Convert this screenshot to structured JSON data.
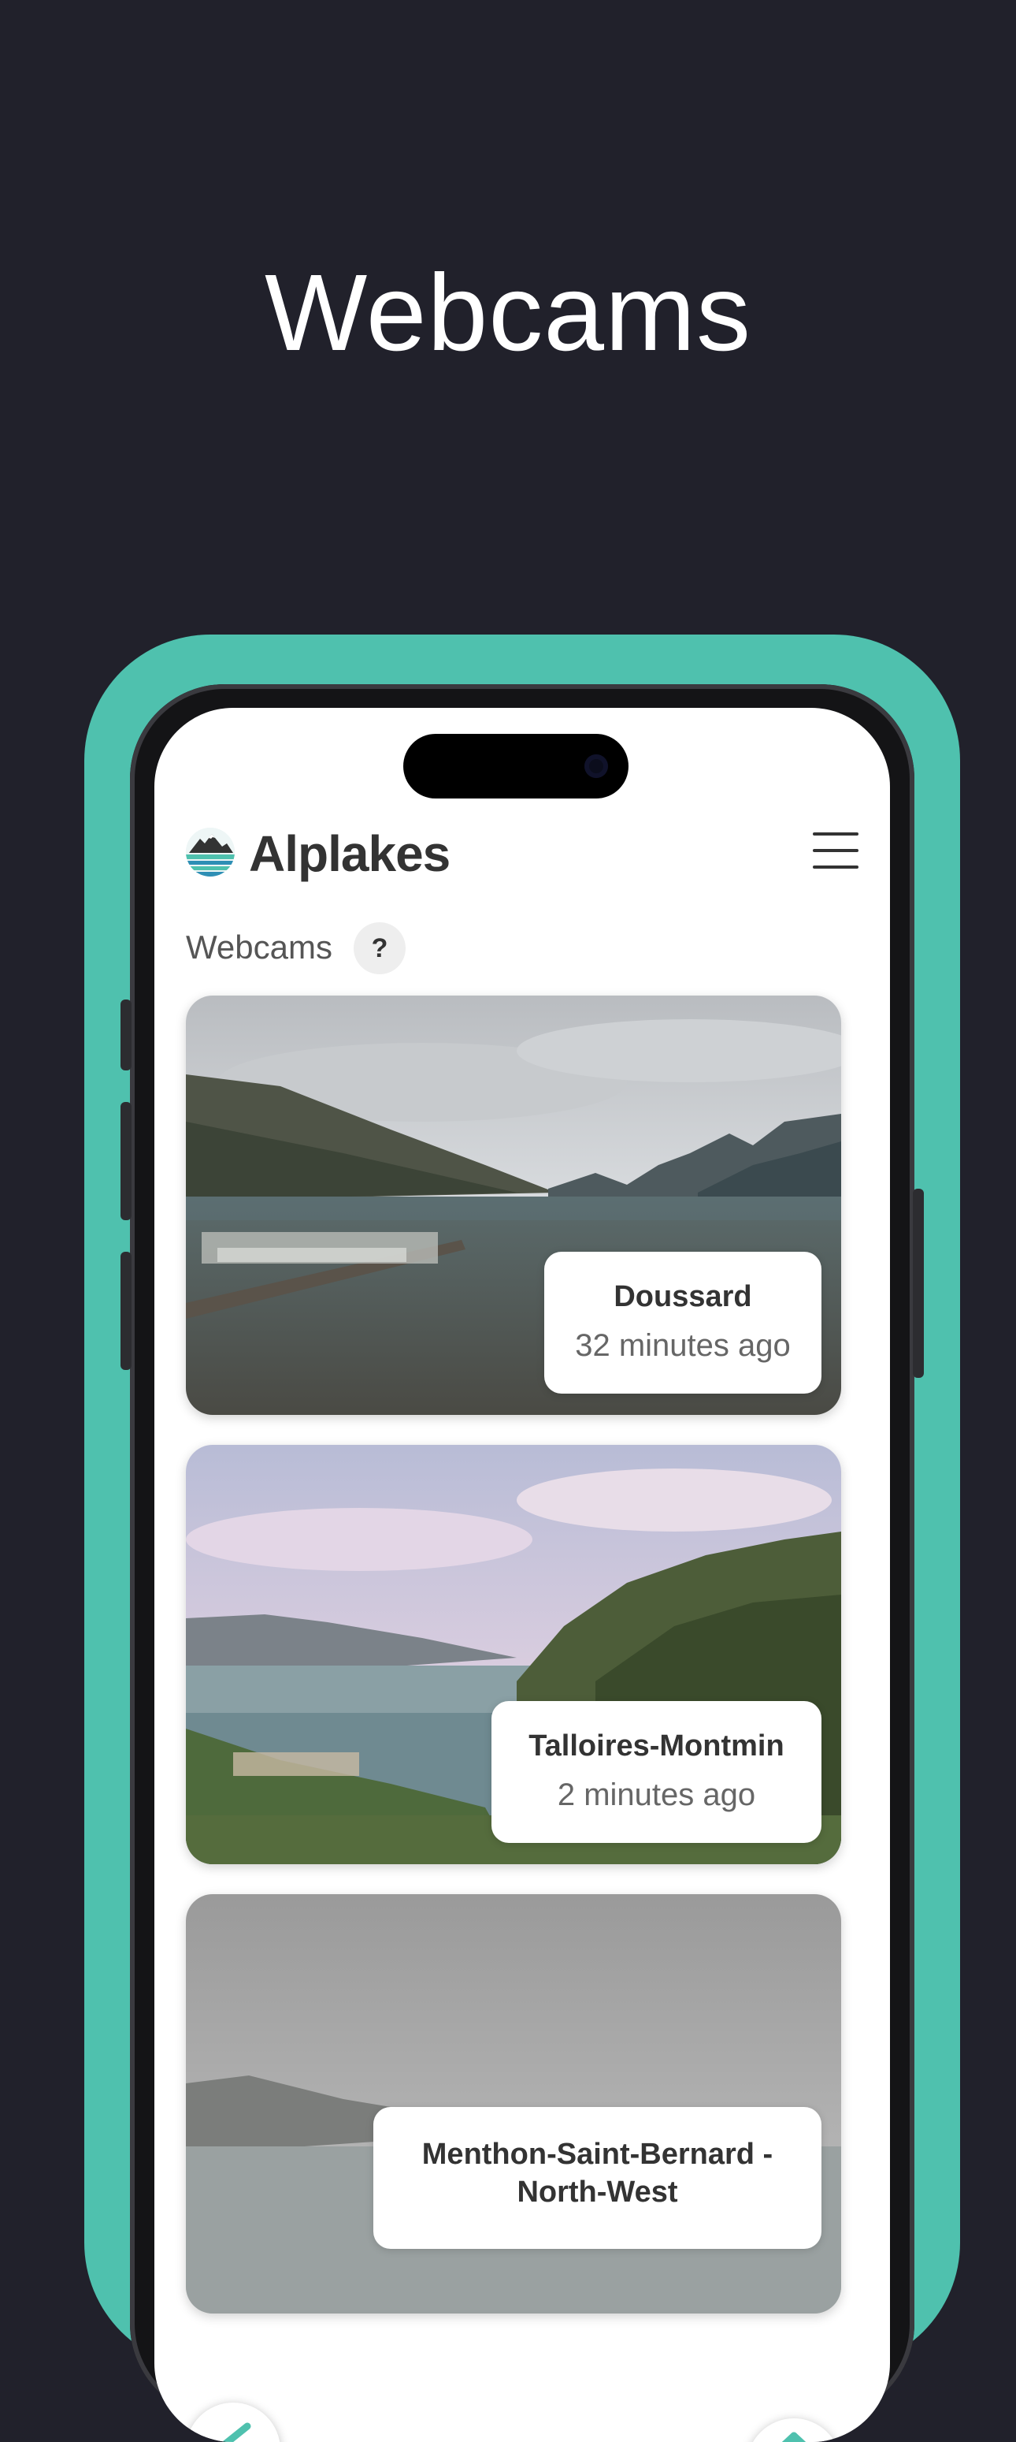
{
  "headline": "Webcams",
  "app": {
    "name": "Alplakes",
    "section_label": "Webcams",
    "help_label": "?"
  },
  "webcams": [
    {
      "name": "Doussard",
      "updated": "32 minutes ago"
    },
    {
      "name": "Talloires-Montmin",
      "updated": "2 minutes ago"
    },
    {
      "name": "Menthon-Saint-Bernard - North-West",
      "updated": ""
    }
  ],
  "colors": {
    "background": "#21212b",
    "frame": "#4fc1ae",
    "accent": "#4fc1ae"
  },
  "icons": [
    "alplakes-logo-icon",
    "hamburger-menu-icon",
    "help-icon",
    "back-icon",
    "scroll-top-icon"
  ]
}
